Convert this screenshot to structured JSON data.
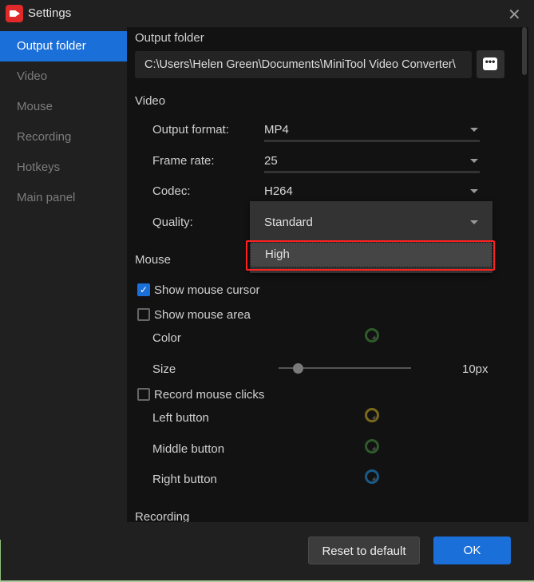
{
  "window": {
    "title": "Settings"
  },
  "sidebar": {
    "items": [
      {
        "label": "Output folder"
      },
      {
        "label": "Video"
      },
      {
        "label": "Mouse"
      },
      {
        "label": "Recording"
      },
      {
        "label": "Hotkeys"
      },
      {
        "label": "Main panel"
      }
    ]
  },
  "output": {
    "heading": "Output folder",
    "path": "C:\\Users\\Helen Green\\Documents\\MiniTool Video Converter\\",
    "browse": "•••"
  },
  "video": {
    "heading": "Video",
    "format_label": "Output format:",
    "format": "MP4",
    "fps_label": "Frame rate:",
    "fps": "25",
    "codec_label": "Codec:",
    "codec": "H264",
    "quality_label": "Quality:",
    "quality": "Standard",
    "quality_options": [
      "High"
    ]
  },
  "mouse": {
    "heading": "Mouse",
    "show_cursor": "Show mouse cursor",
    "show_area": "Show mouse area",
    "color": "Color",
    "size": "Size",
    "size_value": "10px",
    "size_slider_fraction": 0.14,
    "record_clicks": "Record mouse clicks",
    "left": "Left button",
    "middle": "Middle button",
    "right": "Right button",
    "colors": {
      "area": "#2f5a2a",
      "left": "#7a6a1a",
      "middle": "#2f5a2a",
      "right": "#1a5a86"
    }
  },
  "recording": {
    "heading": "Recording"
  },
  "footer": {
    "reset": "Reset to default",
    "ok": "OK"
  }
}
